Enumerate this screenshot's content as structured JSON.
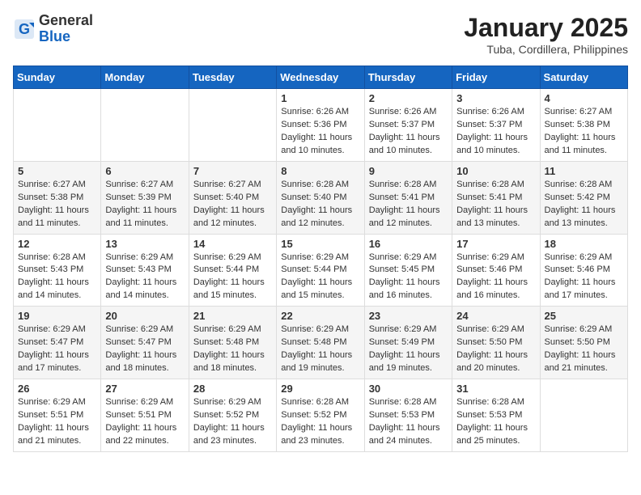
{
  "header": {
    "logo_general": "General",
    "logo_blue": "Blue",
    "month_title": "January 2025",
    "location": "Tuba, Cordillera, Philippines"
  },
  "days_of_week": [
    "Sunday",
    "Monday",
    "Tuesday",
    "Wednesday",
    "Thursday",
    "Friday",
    "Saturday"
  ],
  "weeks": [
    [
      {
        "day": "",
        "info": ""
      },
      {
        "day": "",
        "info": ""
      },
      {
        "day": "",
        "info": ""
      },
      {
        "day": "1",
        "info": "Sunrise: 6:26 AM\nSunset: 5:36 PM\nDaylight: 11 hours and 10 minutes."
      },
      {
        "day": "2",
        "info": "Sunrise: 6:26 AM\nSunset: 5:37 PM\nDaylight: 11 hours and 10 minutes."
      },
      {
        "day": "3",
        "info": "Sunrise: 6:26 AM\nSunset: 5:37 PM\nDaylight: 11 hours and 10 minutes."
      },
      {
        "day": "4",
        "info": "Sunrise: 6:27 AM\nSunset: 5:38 PM\nDaylight: 11 hours and 11 minutes."
      }
    ],
    [
      {
        "day": "5",
        "info": "Sunrise: 6:27 AM\nSunset: 5:38 PM\nDaylight: 11 hours and 11 minutes."
      },
      {
        "day": "6",
        "info": "Sunrise: 6:27 AM\nSunset: 5:39 PM\nDaylight: 11 hours and 11 minutes."
      },
      {
        "day": "7",
        "info": "Sunrise: 6:27 AM\nSunset: 5:40 PM\nDaylight: 11 hours and 12 minutes."
      },
      {
        "day": "8",
        "info": "Sunrise: 6:28 AM\nSunset: 5:40 PM\nDaylight: 11 hours and 12 minutes."
      },
      {
        "day": "9",
        "info": "Sunrise: 6:28 AM\nSunset: 5:41 PM\nDaylight: 11 hours and 12 minutes."
      },
      {
        "day": "10",
        "info": "Sunrise: 6:28 AM\nSunset: 5:41 PM\nDaylight: 11 hours and 13 minutes."
      },
      {
        "day": "11",
        "info": "Sunrise: 6:28 AM\nSunset: 5:42 PM\nDaylight: 11 hours and 13 minutes."
      }
    ],
    [
      {
        "day": "12",
        "info": "Sunrise: 6:28 AM\nSunset: 5:43 PM\nDaylight: 11 hours and 14 minutes."
      },
      {
        "day": "13",
        "info": "Sunrise: 6:29 AM\nSunset: 5:43 PM\nDaylight: 11 hours and 14 minutes."
      },
      {
        "day": "14",
        "info": "Sunrise: 6:29 AM\nSunset: 5:44 PM\nDaylight: 11 hours and 15 minutes."
      },
      {
        "day": "15",
        "info": "Sunrise: 6:29 AM\nSunset: 5:44 PM\nDaylight: 11 hours and 15 minutes."
      },
      {
        "day": "16",
        "info": "Sunrise: 6:29 AM\nSunset: 5:45 PM\nDaylight: 11 hours and 16 minutes."
      },
      {
        "day": "17",
        "info": "Sunrise: 6:29 AM\nSunset: 5:46 PM\nDaylight: 11 hours and 16 minutes."
      },
      {
        "day": "18",
        "info": "Sunrise: 6:29 AM\nSunset: 5:46 PM\nDaylight: 11 hours and 17 minutes."
      }
    ],
    [
      {
        "day": "19",
        "info": "Sunrise: 6:29 AM\nSunset: 5:47 PM\nDaylight: 11 hours and 17 minutes."
      },
      {
        "day": "20",
        "info": "Sunrise: 6:29 AM\nSunset: 5:47 PM\nDaylight: 11 hours and 18 minutes."
      },
      {
        "day": "21",
        "info": "Sunrise: 6:29 AM\nSunset: 5:48 PM\nDaylight: 11 hours and 18 minutes."
      },
      {
        "day": "22",
        "info": "Sunrise: 6:29 AM\nSunset: 5:48 PM\nDaylight: 11 hours and 19 minutes."
      },
      {
        "day": "23",
        "info": "Sunrise: 6:29 AM\nSunset: 5:49 PM\nDaylight: 11 hours and 19 minutes."
      },
      {
        "day": "24",
        "info": "Sunrise: 6:29 AM\nSunset: 5:50 PM\nDaylight: 11 hours and 20 minutes."
      },
      {
        "day": "25",
        "info": "Sunrise: 6:29 AM\nSunset: 5:50 PM\nDaylight: 11 hours and 21 minutes."
      }
    ],
    [
      {
        "day": "26",
        "info": "Sunrise: 6:29 AM\nSunset: 5:51 PM\nDaylight: 11 hours and 21 minutes."
      },
      {
        "day": "27",
        "info": "Sunrise: 6:29 AM\nSunset: 5:51 PM\nDaylight: 11 hours and 22 minutes."
      },
      {
        "day": "28",
        "info": "Sunrise: 6:29 AM\nSunset: 5:52 PM\nDaylight: 11 hours and 23 minutes."
      },
      {
        "day": "29",
        "info": "Sunrise: 6:28 AM\nSunset: 5:52 PM\nDaylight: 11 hours and 23 minutes."
      },
      {
        "day": "30",
        "info": "Sunrise: 6:28 AM\nSunset: 5:53 PM\nDaylight: 11 hours and 24 minutes."
      },
      {
        "day": "31",
        "info": "Sunrise: 6:28 AM\nSunset: 5:53 PM\nDaylight: 11 hours and 25 minutes."
      },
      {
        "day": "",
        "info": ""
      }
    ]
  ]
}
